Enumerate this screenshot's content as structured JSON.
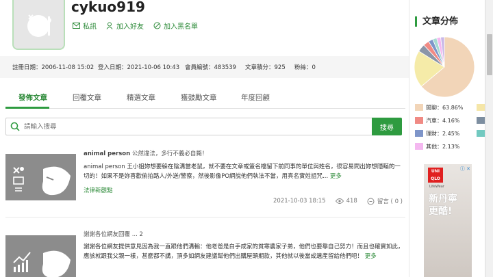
{
  "profile": {
    "username": "cykuo919",
    "actions": [
      {
        "label": "私訊",
        "icon": "mail-icon"
      },
      {
        "label": "加入好友",
        "icon": "add-friend-icon"
      },
      {
        "label": "加入黑名單",
        "icon": "block-icon"
      }
    ],
    "stats": [
      "註冊日期：2006-11-08 15:02",
      "登入日期：2021-10-06 10:43",
      "會員編號：483539",
      "文章積分：925",
      "粉絲：0"
    ]
  },
  "tabs": [
    "發佈文章",
    "回覆文章",
    "精選文章",
    "獲鼓勵文章",
    "年度回顧"
  ],
  "search": {
    "placeholder": "請輸入搜尋",
    "button": "搜尋"
  },
  "posts": [
    {
      "title_author": "animal person",
      "title_rest": " 公然違法，多行不義必自斃！",
      "body": "animal person 王小姐妳想要躲在陰溝當老鼠，就不要在文章或簽名檔留下前同事的單位與姓名，很容易問出妳想隱瞞的一切的！如果不是妳喜歡偷拍路人/外送/警察，然後影像PO網說他們執法不當，用真名實姓詛咒...",
      "more": "更多",
      "category": "法律新觀點",
      "date": "2021-10-03 18:15",
      "views": "418",
      "comments": "留言 ( 0 )"
    },
    {
      "title_author": "",
      "title_rest": "謝謝各位網友回覆 ... 2",
      "body": "謝謝各位網友提供意見因為我一直跟他們溝輸：他老爸是白手成家的貧寒農家子弟，他們也要靠自己努力！而且也確實如此，應該就跟我父親一樣，甚麼都不講，頂多如網友建議幫他們出購屋頭期款，其他就以後當成遺產留給他們吧！",
      "more": "更多"
    }
  ],
  "sidebar": {
    "title": "文章分佈",
    "legend": [
      {
        "label": "閒聊：63.86%",
        "color": "#f2d5b8"
      },
      {
        "label": "汽車：4.16%",
        "color": "#f08a84"
      },
      {
        "label": "理財：2.45%",
        "color": "#7e95c9"
      },
      {
        "label": "其他：2.13%",
        "color": "#f4b8f0"
      }
    ],
    "legend_right_colors": [
      "#f5e6a8",
      "#7d8ea0",
      "#72c9c0"
    ],
    "pie_values": [
      63.86,
      20.0,
      4.16,
      3.2,
      2.45,
      2.2,
      2.13,
      2.0
    ],
    "pie_colors": [
      "#f2d5b8",
      "#f5eba8",
      "#8a95a8",
      "#f08a84",
      "#7e95c9",
      "#a7dad2",
      "#f4b8f0",
      "#c9b8e8"
    ]
  },
  "ad": {
    "logo": "UNI QLO UNI QLO",
    "brand": "LifeWear",
    "text1": "新丹寧",
    "text2": "更酷!"
  },
  "colors": {
    "accent": "#2e9b40"
  }
}
